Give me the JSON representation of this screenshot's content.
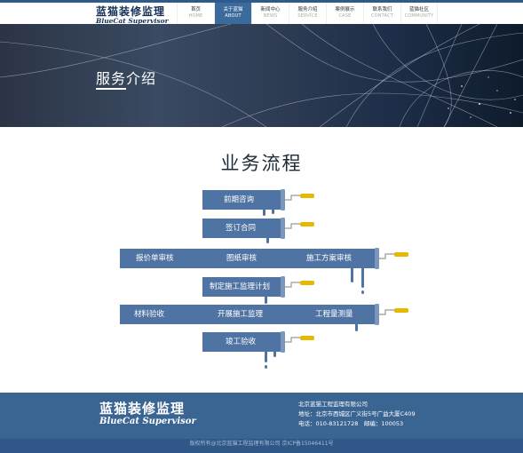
{
  "header": {
    "logo_cn": "蓝猫装修监理",
    "logo_en": "BlueCat Supervisor",
    "nav": [
      {
        "cn": "首页",
        "en": "HOME"
      },
      {
        "cn": "关于蓝猫",
        "en": "ABOUT"
      },
      {
        "cn": "新闻中心",
        "en": "NEWS"
      },
      {
        "cn": "服务介绍",
        "en": "SERVICE"
      },
      {
        "cn": "案例展示",
        "en": "CASE"
      },
      {
        "cn": "联系我们",
        "en": "CONTACT"
      },
      {
        "cn": "蓝猫社区",
        "en": "COMMUNITY"
      }
    ],
    "active_index": 1
  },
  "banner": {
    "title": "服务介绍"
  },
  "main": {
    "section_title": "业务流程",
    "steps": [
      {
        "labels": [
          "前期咨询"
        ]
      },
      {
        "labels": [
          "签订合同"
        ]
      },
      {
        "labels": [
          "报价单审核",
          "图纸审核",
          "施工方案审核"
        ]
      },
      {
        "labels": [
          "制定施工监理计划"
        ]
      },
      {
        "labels": [
          "材料验收",
          "开展施工监理",
          "工程量测量"
        ]
      },
      {
        "labels": [
          "竣工验收"
        ]
      }
    ]
  },
  "footer": {
    "logo_cn": "蓝猫装修监理",
    "logo_en": "BlueCat Supervisor",
    "company": "北京蓝猫工程监理有限公司",
    "address": "地址：北京市西城区广义街5号广益大厦C409",
    "contact": "电话：010-83121728　邮编：100053",
    "copyright": "版权所有@北京蓝猫工程监理有限公司 京ICP备15046411号"
  },
  "colors": {
    "accent": "#4f73a3",
    "roller_handle": "#e6b800",
    "footer": "#3a6593"
  }
}
